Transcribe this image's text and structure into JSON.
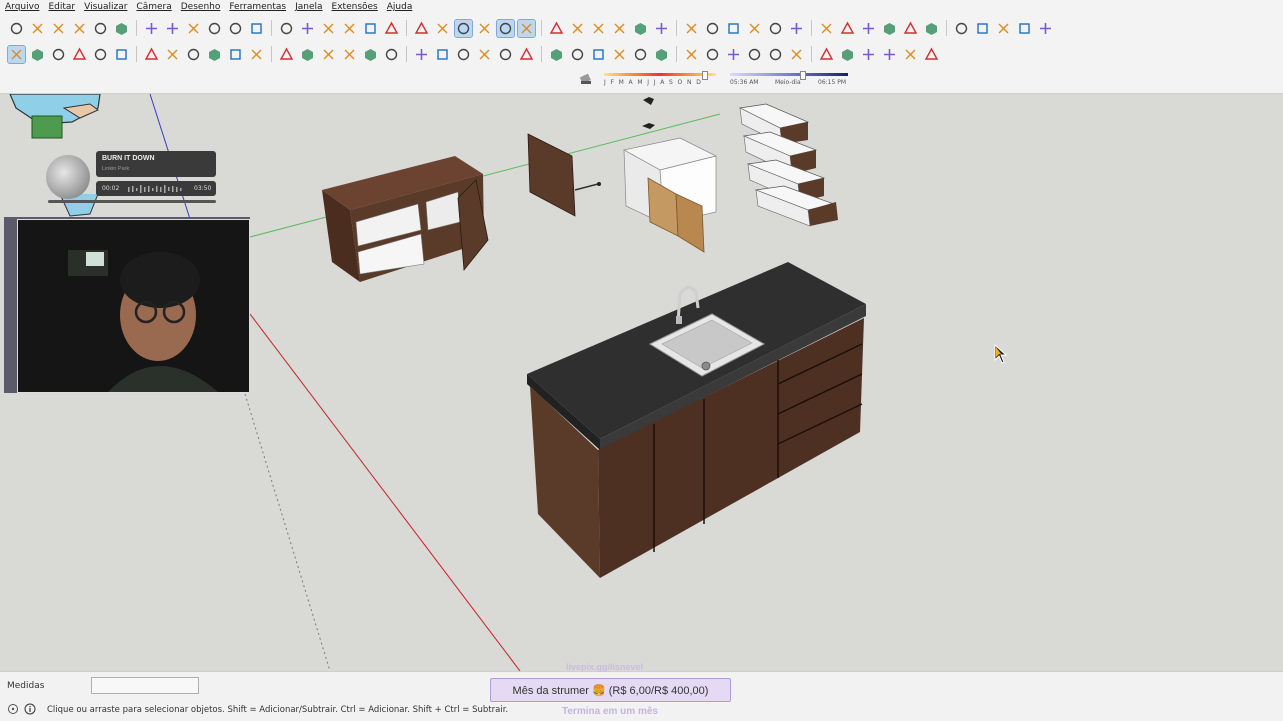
{
  "menu": [
    "Arquivo",
    "Editar",
    "Visualizar",
    "Câmera",
    "Desenho",
    "Ferramentas",
    "Janela",
    "Extensões",
    "Ajuda"
  ],
  "shadow": {
    "months": "J  F  M  A  M  J  J  A  S  O  N  D",
    "time_start": "05:36 AM",
    "time_mid": "Meio-dia",
    "time_end": "06:15 PM"
  },
  "music": {
    "title": "BURN IT DOWN",
    "artist": "Linkin Park",
    "elapsed": "00:02",
    "duration": "03:50"
  },
  "status": {
    "measurements_label": "Medidas",
    "measurements_value": "",
    "hint": "Clique ou arraste para selecionar objetos. Shift = Adicionar/Subtrair. Ctrl = Adicionar. Shift + Ctrl = Subtrair."
  },
  "goal": {
    "top_text": "livepix.gg/lisnevel",
    "label": "Mês da strumer 🍔 (R$ 6,00/R$ 400,00)",
    "bottom_text": "Termina em um mês"
  },
  "colors": {
    "toolbar_bg": "#f3f3f3",
    "viewport_bg": "#d9d9d5",
    "axis_red": "#c8202a",
    "axis_green": "#4caf50",
    "axis_blue": "#3a3ac8",
    "wood": "#5a3a28",
    "granite": "#3a3a3a",
    "goal_bg": "#e4daf3"
  },
  "toolbar_icons_row1": [
    "new-file-icon",
    "open-folder-icon",
    "save-icon",
    "cut-icon",
    "copy-icon",
    "paste-icon",
    "erase-icon",
    "undo-icon",
    "redo-icon",
    "print-icon",
    "model-info-icon",
    "iso-view-icon",
    "top-view-icon",
    "front-view-icon",
    "right-view-icon",
    "back-view-icon",
    "left-view-icon",
    "xray-icon",
    "wireframe-icon",
    "hidden-line-icon",
    "shaded-icon",
    "shaded-textures-icon",
    "monochrome-icon",
    "section-plane-icon",
    "section-display-icon",
    "section-cut-icon",
    "components-icon",
    "materials-icon",
    "styles-icon",
    "layers-icon",
    "scenes-icon",
    "sandbox-icon",
    "orbit-icon",
    "pan-icon",
    "zoom-icon",
    "zoom-extents-icon",
    "add-location-icon",
    "toggle-terrain-icon",
    "warehouse-icon",
    "extension-warehouse-icon",
    "share-icon",
    "cloud-icon",
    "settings-icon",
    "layout-icon",
    "info-icon",
    "cart-icon",
    "account-icon"
  ],
  "toolbar_icons_row2": [
    "select-icon",
    "component-icon",
    "paint-bucket-icon",
    "eraser-icon",
    "line-icon",
    "freehand-icon",
    "rectangle-icon",
    "rotated-rectangle-icon",
    "circle-icon",
    "polygon-icon",
    "arc-icon",
    "two-point-arc-icon",
    "pie-icon",
    "three-point-arc-icon",
    "move-icon",
    "push-pull-icon",
    "rotate-icon",
    "follow-me-icon",
    "scale-icon",
    "offset-icon",
    "tape-measure-icon",
    "dimension-icon",
    "protractor-icon",
    "text-icon",
    "axes-icon",
    "3d-text-icon",
    "orbit-icon",
    "pan-icon",
    "zoom-icon",
    "zoom-window-icon",
    "zoom-extents-icon",
    "previous-view-icon",
    "position-camera-icon",
    "look-around-icon",
    "walk-icon",
    "section-plane-icon",
    "box-icon",
    "solid-box-icon",
    "intersect-icon",
    "sandbox-smoove-icon",
    "dimension-tool-icon",
    "grid-icon"
  ]
}
